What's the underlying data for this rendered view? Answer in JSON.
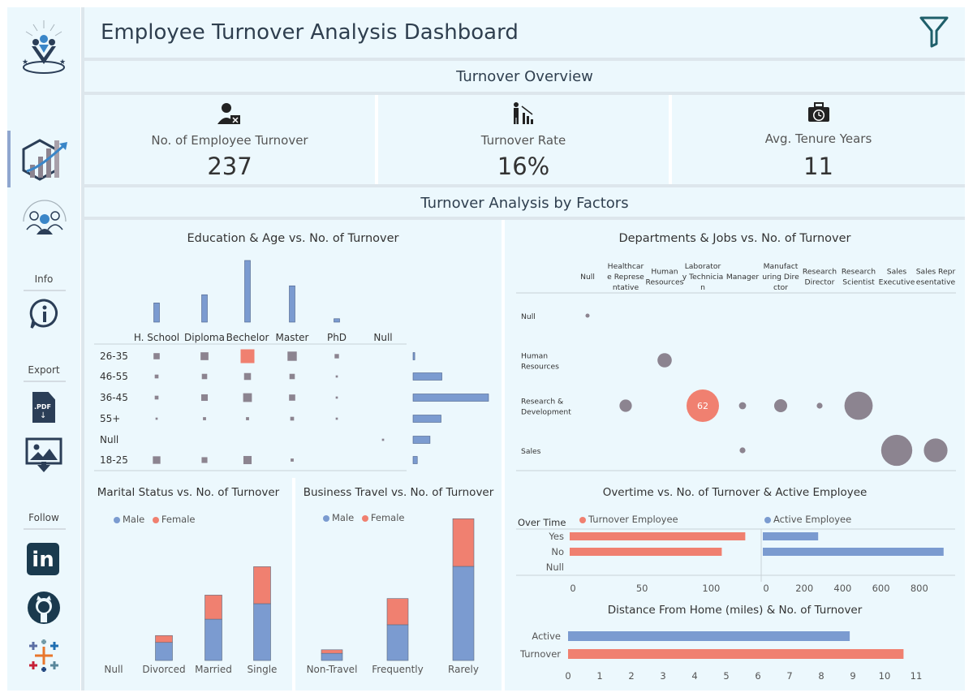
{
  "header": {
    "title": "Employee Turnover Analysis Dashboard"
  },
  "sidebar": {
    "info_label": "Info",
    "export_label": "Export",
    "follow_label": "Follow",
    "pdf_label": ".PDF"
  },
  "overview": {
    "title": "Turnover Overview",
    "kpis": [
      {
        "label": "No. of Employee Turnover",
        "value": "237"
      },
      {
        "label": "Turnover Rate",
        "value": "16%"
      },
      {
        "label": "Avg. Tenure Years",
        "value": "11"
      }
    ]
  },
  "factors": {
    "title": "Turnover Analysis by Factors"
  },
  "colors": {
    "male": "#7b9bd0",
    "female": "#f08070",
    "bubble": "#8c8490",
    "highlight": "#f08070",
    "panel": "#ecf8fd",
    "separator": "#dde6ec"
  },
  "chart_data": [
    {
      "type": "heatmap",
      "title": "Education & Age vs. No. of Turnover",
      "education": [
        "H. School",
        "Diploma",
        "Bechelor",
        "Master",
        "PhD",
        "Null"
      ],
      "education_totals": [
        28,
        40,
        90,
        53,
        5,
        0
      ],
      "age_groups": [
        "26-35",
        "46-55",
        "36-45",
        "55+",
        "Null",
        "18-25"
      ],
      "age_totals": [
        2,
        34,
        89,
        33,
        20,
        5
      ],
      "cells": [
        [
          8,
          13,
          40,
          18,
          4,
          0
        ],
        [
          3,
          6,
          10,
          6,
          1,
          0
        ],
        [
          3,
          9,
          16,
          8,
          1,
          0
        ],
        [
          1,
          2,
          2,
          3,
          1,
          0
        ],
        [
          0,
          0,
          0,
          0,
          0,
          1
        ],
        [
          12,
          7,
          14,
          2,
          0,
          0
        ]
      ],
      "highlight": {
        "row": "26-35",
        "column": "Bechelor"
      }
    },
    {
      "type": "scatter",
      "title": "Departments & Jobs vs. No. of Turnover",
      "jobs": [
        "Null",
        "Healthcare Representative",
        "Human Resources",
        "Laboratory Technician",
        "Manager",
        "Manufacturing Director",
        "Research Director",
        "Research Scientist",
        "Sales Executive",
        "Sales Representative"
      ],
      "job_labels": [
        [
          "Null"
        ],
        [
          "Healthcar",
          "e Represe",
          "ntative"
        ],
        [
          "Human",
          "Resources"
        ],
        [
          "Laborator",
          "y Technicia",
          "n"
        ],
        [
          "Manager"
        ],
        [
          "Manufact",
          "uring Dire",
          "ctor"
        ],
        [
          "Research",
          "Director"
        ],
        [
          "Research",
          "Scientist"
        ],
        [
          "Sales",
          "Executive"
        ],
        [
          "Sales Repr",
          "esentative"
        ]
      ],
      "departments": [
        "Null",
        "Human Resources",
        "Research & Development",
        "Sales"
      ],
      "department_labels": [
        [
          "Null"
        ],
        [
          "Human",
          "Resources"
        ],
        [
          "Research &",
          "Development"
        ],
        [
          "Sales"
        ]
      ],
      "points": [
        {
          "department": "Null",
          "job": "Null",
          "value": 1
        },
        {
          "department": "Human Resources",
          "job": "Human Resources",
          "value": 12
        },
        {
          "department": "Research & Development",
          "job": "Healthcare Representative",
          "value": 9
        },
        {
          "department": "Research & Development",
          "job": "Laboratory Technician",
          "value": 62,
          "label": "62"
        },
        {
          "department": "Research & Development",
          "job": "Manager",
          "value": 3
        },
        {
          "department": "Research & Development",
          "job": "Manufacturing Director",
          "value": 10
        },
        {
          "department": "Research & Development",
          "job": "Research Director",
          "value": 2
        },
        {
          "department": "Research & Development",
          "job": "Research Scientist",
          "value": 47
        },
        {
          "department": "Sales",
          "job": "Manager",
          "value": 2
        },
        {
          "department": "Sales",
          "job": "Sales Executive",
          "value": 57
        },
        {
          "department": "Sales",
          "job": "Sales Representative",
          "value": 33
        }
      ]
    },
    {
      "type": "bar",
      "stacked": true,
      "title": "Marital Status vs. No. of Turnover",
      "categories": [
        "Null",
        "Divorced",
        "Married",
        "Single"
      ],
      "series": [
        {
          "name": "Male",
          "values": [
            0,
            21,
            48,
            66
          ]
        },
        {
          "name": "Female",
          "values": [
            0,
            8,
            28,
            43
          ]
        }
      ],
      "legend": "top-left"
    },
    {
      "type": "bar",
      "stacked": true,
      "title": "Business Travel vs. No. of Turnover",
      "categories": [
        "Non-Travel",
        "Frequently",
        "Rarely"
      ],
      "series": [
        {
          "name": "Male",
          "values": [
            6,
            30,
            79
          ]
        },
        {
          "name": "Female",
          "values": [
            3,
            22,
            40
          ]
        }
      ],
      "legend": "top-left"
    },
    {
      "type": "bar",
      "orientation": "horizontal",
      "title": "Overtime vs. No. of Turnover & Active Employee",
      "row_header": "Over Time",
      "categories": [
        "Yes",
        "No",
        "Null"
      ],
      "series": [
        {
          "name": "Turnover Employee",
          "values": [
            127,
            110,
            0
          ],
          "axis_ticks": [
            0,
            50,
            100
          ],
          "xlim": [
            0,
            135
          ]
        },
        {
          "name": "Active Employee",
          "values": [
            289,
            944,
            0
          ],
          "axis_ticks": [
            0,
            200,
            400,
            600,
            800
          ],
          "xlim": [
            0,
            1000
          ]
        }
      ]
    },
    {
      "type": "bar",
      "orientation": "horizontal",
      "title": "Distance From Home (miles) & No. of Turnover",
      "categories": [
        "Active",
        "Turnover"
      ],
      "values": [
        8.9,
        10.6
      ],
      "x_ticks": [
        0,
        1,
        2,
        3,
        4,
        5,
        6,
        7,
        8,
        9,
        10,
        11
      ],
      "xlim": [
        0,
        11
      ]
    }
  ]
}
